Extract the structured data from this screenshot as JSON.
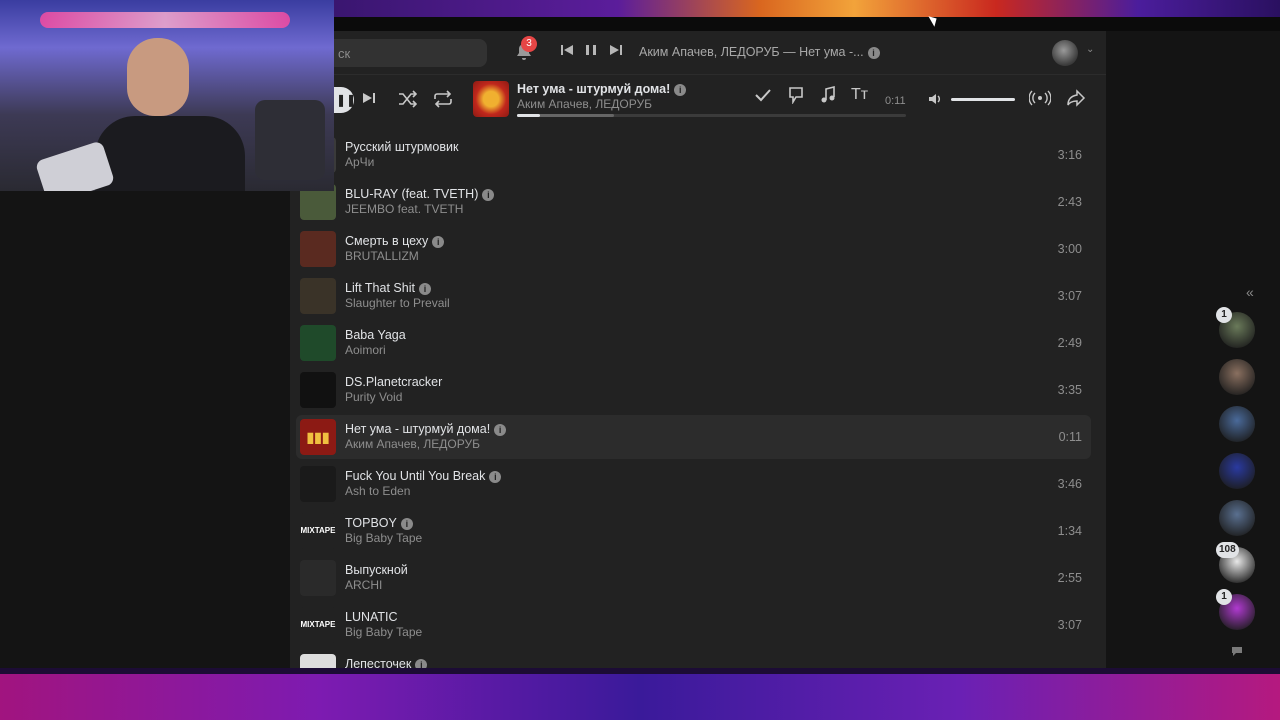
{
  "header": {
    "search_placeholder": "ск",
    "notifications_count": "3",
    "now_playing_text": "Аким Апачев, ЛЕДОРУБ — Нет ума -...",
    "info_icon": "i"
  },
  "player": {
    "title": "Нет ума - штурмуй дома!",
    "artist": "Аким Апачев, ЛЕДОРУБ",
    "time": "0:11",
    "progress_fraction": 0.06,
    "buffer_fraction": 0.25,
    "volume_fraction": 1.0,
    "icons": [
      "pause-icon",
      "next-icon",
      "shuffle-icon",
      "repeat-icon",
      "check-icon",
      "dislike-icon",
      "music-note-icon",
      "lyrics-icon",
      "volume-icon",
      "broadcast-icon",
      "share-icon"
    ]
  },
  "tracks": [
    {
      "title": "Русский штурмовик",
      "artist": "АрЧи",
      "duration": "3:16",
      "explicit": false,
      "cover_color": "#3a3a3a"
    },
    {
      "title": "BLU-RAY (feat. TVETH)",
      "artist": "JEEMBO feat. TVETH",
      "duration": "2:43",
      "explicit": true,
      "cover_color": "#4a5a3a"
    },
    {
      "title": "Смерть в цеху",
      "artist": "BRUTALLIZM",
      "duration": "3:00",
      "explicit": true,
      "cover_color": "#5a2a20"
    },
    {
      "title": "Lift That Shit",
      "artist": "Slaughter to Prevail",
      "duration": "3:07",
      "explicit": true,
      "cover_color": "#3a3328"
    },
    {
      "title": "Baba Yaga",
      "artist": "Aoimori",
      "duration": "2:49",
      "explicit": false,
      "cover_color": "#1f4a2a"
    },
    {
      "title": "DS.Planetcracker",
      "artist": "Purity Void",
      "duration": "3:35",
      "explicit": false,
      "cover_color": "#111111"
    },
    {
      "title": "Нет ума - штурмуй дома!",
      "artist": "Аким Апачев, ЛЕДОРУБ",
      "duration": "0:11",
      "explicit": true,
      "cover_color": "#8c1a14",
      "active": true
    },
    {
      "title": "Fuck You Until You Break",
      "artist": "Ash to Eden",
      "duration": "3:46",
      "explicit": true,
      "cover_color": "#1a1a1a"
    },
    {
      "title": "TOPBOY",
      "artist": "Big Baby Tape",
      "duration": "1:34",
      "explicit": true,
      "cover_color": "#222222",
      "cover_text": "MIXTAPE"
    },
    {
      "title": "Выпускной",
      "artist": "ARCHI",
      "duration": "2:55",
      "explicit": false,
      "cover_color": "#2a2a2a"
    },
    {
      "title": "LUNATIC",
      "artist": "Big Baby Tape",
      "duration": "3:07",
      "explicit": false,
      "cover_color": "#222222",
      "cover_text": "MIXTAPE"
    },
    {
      "title": "Лепесточек",
      "artist": "",
      "duration": "",
      "explicit": true,
      "cover_color": "#dddddd"
    }
  ],
  "sidebar_contacts": [
    {
      "badge": "1",
      "color": "#6a7a5a"
    },
    {
      "badge": "",
      "color": "#8a7060"
    },
    {
      "badge": "",
      "color": "#4a6a9a"
    },
    {
      "badge": "",
      "color": "#2a3aa0"
    },
    {
      "badge": "",
      "color": "#5a7090"
    },
    {
      "badge": "108",
      "color": "#e8e8e8"
    },
    {
      "badge": "1",
      "color": "#b03ad0"
    }
  ],
  "colors": {
    "accent": "#e1e3e6",
    "badge_red": "#e64646",
    "panel": "#222222"
  }
}
